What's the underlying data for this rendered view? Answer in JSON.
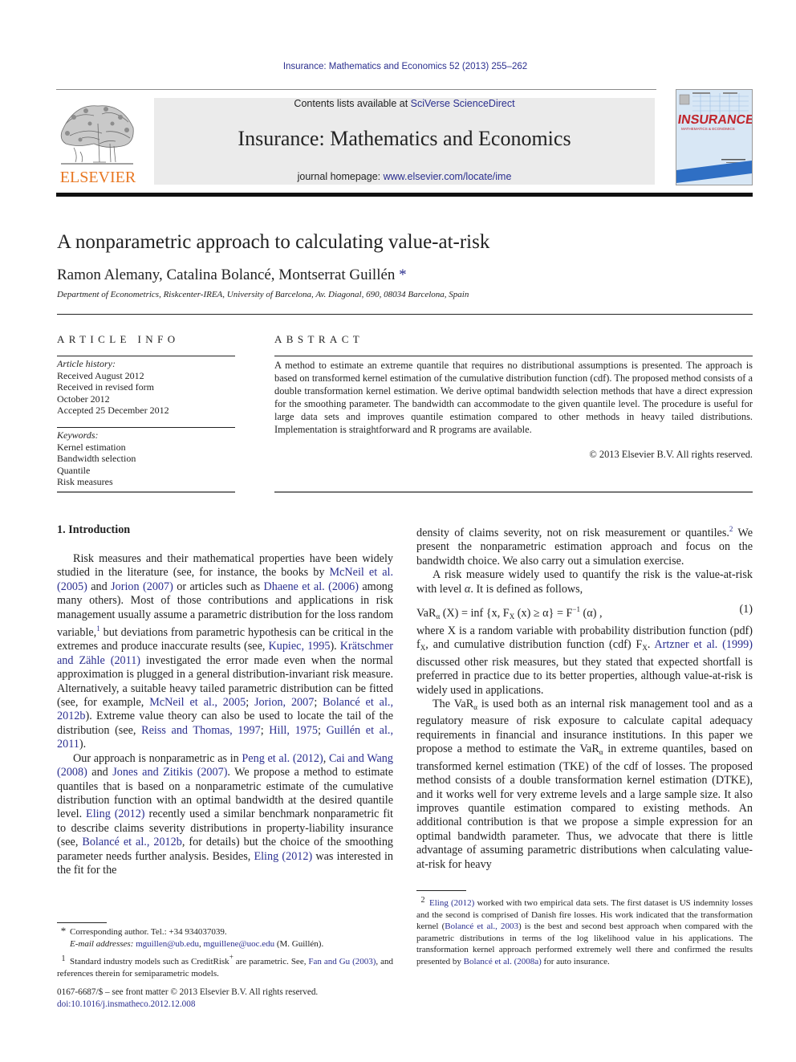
{
  "header": {
    "journal_reference": "Insurance: Mathematics and Economics 52 (2013) 255–262",
    "contents_prefix": "Contents lists available at ",
    "contents_link": "SciVerse ScienceDirect",
    "journal_title": "Insurance: Mathematics and Economics",
    "homepage_prefix": "journal homepage: ",
    "homepage_link": "www.elsevier.com/locate/ime",
    "publisher_logo_text": "ELSEVIER",
    "cover_title": "INSURANCE",
    "cover_subtitle": "MATHEMATICS & ECONOMICS"
  },
  "colors": {
    "link": "#2b2f8f",
    "elsevier_orange": "#e87722",
    "header_band": "#ebebeb",
    "cover_red": "#c0262d",
    "cover_blue": "#2f6fc4"
  },
  "article": {
    "title": "A nonparametric approach to calculating value-at-risk",
    "authors": "Ramon Alemany, Catalina Bolancé, Montserrat Guillén",
    "author_mark": "*",
    "affiliation": "Department of Econometrics, Riskcenter-IREA, University of Barcelona, Av. Diagonal, 690, 08034 Barcelona, Spain"
  },
  "article_info": {
    "heading": "ARTICLE INFO",
    "history_label": "Article history:",
    "history": [
      "Received August 2012",
      "Received in revised form",
      "October 2012",
      "Accepted 25 December 2012"
    ],
    "keywords_label": "Keywords:",
    "keywords": [
      "Kernel estimation",
      "Bandwidth selection",
      "Quantile",
      "Risk measures"
    ]
  },
  "abstract": {
    "heading": "ABSTRACT",
    "text": "A method to estimate an extreme quantile that requires no distributional assumptions is presented. The approach is based on transformed kernel estimation of the cumulative distribution function (cdf). The proposed method consists of a double transformation kernel estimation. We derive optimal bandwidth selection methods that have a direct expression for the smoothing parameter. The bandwidth can accommodate to the given quantile level. The procedure is useful for large data sets and improves quantile estimation compared to other methods in heavy tailed distributions. Implementation is straightforward and R programs are available.",
    "copyright": "© 2013 Elsevier B.V. All rights reserved."
  },
  "introduction": {
    "heading": "1.  Introduction",
    "p1": {
      "t1": "Risk measures and their mathematical properties have been widely studied in the literature (see, for instance, the books by ",
      "l1": "McNeil et al. (2005)",
      "t2": " and ",
      "l2": "Jorion (2007)",
      "t3": " or articles such as ",
      "l3": "Dhaene et al. (2006)",
      "t4": " among many others). Most of those contributions and applications in risk management usually assume a parametric distribution for the loss random variable,",
      "fn1": "1",
      "t5": " but deviations from parametric hypothesis can be critical in the extremes and produce inaccurate results (see, ",
      "l4": "Kupiec, 1995",
      "t6": "). ",
      "l5": "Krätschmer and Zähle (2011)",
      "t7": " investigated the error made even when the normal approximation is plugged in a general distribution-invariant risk measure. Alternatively, a suitable heavy tailed parametric distribution can be fitted (see, for example, ",
      "l6": "McNeil et al., 2005",
      "t8": "; ",
      "l7": "Jorion, 2007",
      "t9": "; ",
      "l8": "Bolancé et al., 2012b",
      "t10": "). Extreme value theory can also be used to locate the tail of the distribution (see, ",
      "l9": "Reiss and Thomas, 1997",
      "t11": "; ",
      "l10": "Hill, 1975",
      "t12": "; ",
      "l11": "Guillén et al., 2011",
      "t13": ")."
    },
    "p2": {
      "t1": "Our approach is nonparametric as in ",
      "l1": "Peng et al. (2012)",
      "t2": ", ",
      "l2": "Cai and Wang (2008)",
      "t3": " and ",
      "l3": "Jones and Zitikis (2007)",
      "t4": ". We propose a method to estimate quantiles that is based on a nonparametric estimate of the cumulative distribution function with an optimal bandwidth at the desired quantile level. ",
      "l4": "Eling (2012)",
      "t5": " recently used a similar benchmark nonparametric fit to describe claims severity distributions in property-liability insurance (see, ",
      "l5": "Bolancé et al., 2012b",
      "t6": ", for details) but the choice of the smoothing parameter needs further analysis. Besides, ",
      "l6": "Eling (2012)",
      "t7": " was interested in the fit for the"
    },
    "p3": {
      "t1": "density of claims severity, not on risk measurement or quantiles.",
      "fn2": "2",
      "t2": " We present the nonparametric estimation approach and focus on the bandwidth choice. We also carry out a simulation exercise."
    },
    "p4": {
      "t1": "A risk measure widely used to quantify the risk is the value-at-risk with level ",
      "alpha": "α",
      "t2": ". It is defined as follows,"
    },
    "equation": {
      "lhs": "VaR",
      "lhs_sub": "α",
      "body": " (X) = inf {x, F",
      "sub_x": "X",
      "body2": " (x) ≥ α} = F",
      "sup_inv": "−1",
      "body3": " (α) ,",
      "number": "(1)"
    },
    "p5": {
      "t1": "where X is a random variable with probability distribution function (pdf) f",
      "s1": "X",
      "t2": ", and cumulative distribution function (cdf) F",
      "s2": "X",
      "t3": ". ",
      "l1": "Artzner et al. (1999)",
      "t4": " discussed other risk measures, but they stated that expected shortfall is preferred in practice due to its better properties, although value-at-risk is widely used in applications."
    },
    "p6": {
      "t1": "The VaR",
      "s1": "α",
      "t2": " is used both as an internal risk management tool and as a regulatory measure of risk exposure to calculate capital adequacy requirements in financial and insurance institutions. In this paper we propose a method to estimate the VaR",
      "s2": "α",
      "t3": " in extreme quantiles, based on transformed kernel estimation (TKE) of the cdf of losses. The proposed method consists of a double transformation kernel estimation (DTKE), and it works well for very extreme levels and a large sample size. It also improves quantile estimation compared to existing methods. An additional contribution is that we propose a simple expression for an optimal bandwidth parameter. Thus, we advocate that there is little advantage of assuming parametric distributions when calculating value-at-risk for heavy"
    }
  },
  "footnotes_left": {
    "star_mark": "*",
    "corresponding": "Corresponding author. Tel.: +34 934037039.",
    "email_label": "E-mail addresses: ",
    "email1": "mguillen@ub.edu",
    "email_sep": ", ",
    "email2": "mguillene@uoc.edu",
    "email_suffix": " (M. Guillén).",
    "fn1_mark": "1",
    "fn1_t1": "Standard industry models such as CreditRisk",
    "fn1_plus": "+",
    "fn1_t2": " are parametric. See, ",
    "fn1_link": "Fan and Gu (2003)",
    "fn1_t3": ", and references therein for semiparametric models."
  },
  "footnotes_right": {
    "fn2_mark": "2",
    "l1": "Eling (2012)",
    "t1": " worked with two empirical data sets. The first dataset is US indemnity losses and the second is comprised of Danish fire losses. His work indicated that the transformation kernel (",
    "l2": "Bolancé et al., 2003",
    "t2": ") is the best and second best approach when compared with the parametric distributions in terms of the log likelihood value in his applications. The transformation kernel approach performed extremely well there and confirmed the results presented by ",
    "l3": "Bolancé et al. (2008a)",
    "t3": " for auto insurance."
  },
  "front_matter": {
    "issn_line": "0167-6687/$ – see front matter © 2013 Elsevier B.V. All rights reserved.",
    "doi": "doi:10.1016/j.insmatheco.2012.12.008"
  }
}
